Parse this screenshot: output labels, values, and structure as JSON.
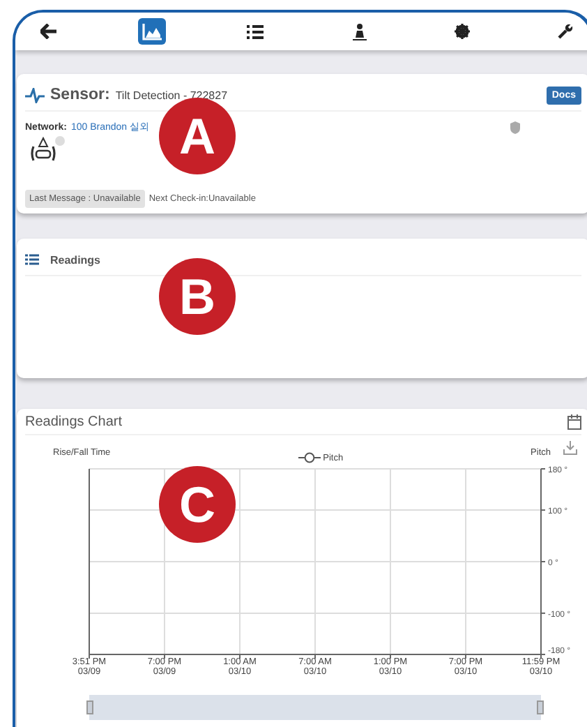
{
  "nav": {
    "tabs": [
      {
        "kind": "back",
        "selected": false
      },
      {
        "kind": "chart",
        "selected": true
      },
      {
        "kind": "list",
        "selected": false
      },
      {
        "kind": "figure",
        "selected": false
      },
      {
        "kind": "gear",
        "selected": false
      },
      {
        "kind": "wrench",
        "selected": false
      }
    ]
  },
  "sensor_card": {
    "label": "Sensor:",
    "name": "Tilt Detection - 722827",
    "docs_button": "Docs",
    "network_label": "Network:",
    "network_link": "100 Brandon 실외",
    "last_message": "Last Message : Unavailable",
    "next_checkin": "Next Check-in:Unavailable"
  },
  "readings_card": {
    "title": "Readings"
  },
  "chart_card": {
    "title": "Readings Chart",
    "left_axis_label": "Rise/Fall Time",
    "chart_data": {
      "type": "line",
      "grid": true,
      "ylabel": "Pitch",
      "ylim": [
        -180,
        180
      ],
      "categories": [
        "3:51 PM\n03/09",
        "7:00 PM\n03/09",
        "1:00 AM\n03/10",
        "7:00 AM\n03/10",
        "1:00 PM\n03/10",
        "7:00 PM\n03/10",
        "11:59 PM\n03/10"
      ],
      "yticks": [
        {
          "value": 180,
          "label": "180 °"
        },
        {
          "value": 100,
          "label": "100 °"
        },
        {
          "value": 0,
          "label": "0 °"
        },
        {
          "value": -100,
          "label": "-100 °"
        },
        {
          "value": -180,
          "label": "-180 °"
        }
      ],
      "series": [
        {
          "name": "Pitch",
          "color": "#555555",
          "values": [
            null,
            null,
            null,
            null,
            null,
            null,
            null
          ]
        }
      ]
    }
  },
  "callouts": [
    {
      "letter": "A"
    },
    {
      "letter": "B"
    },
    {
      "letter": "C"
    }
  ]
}
